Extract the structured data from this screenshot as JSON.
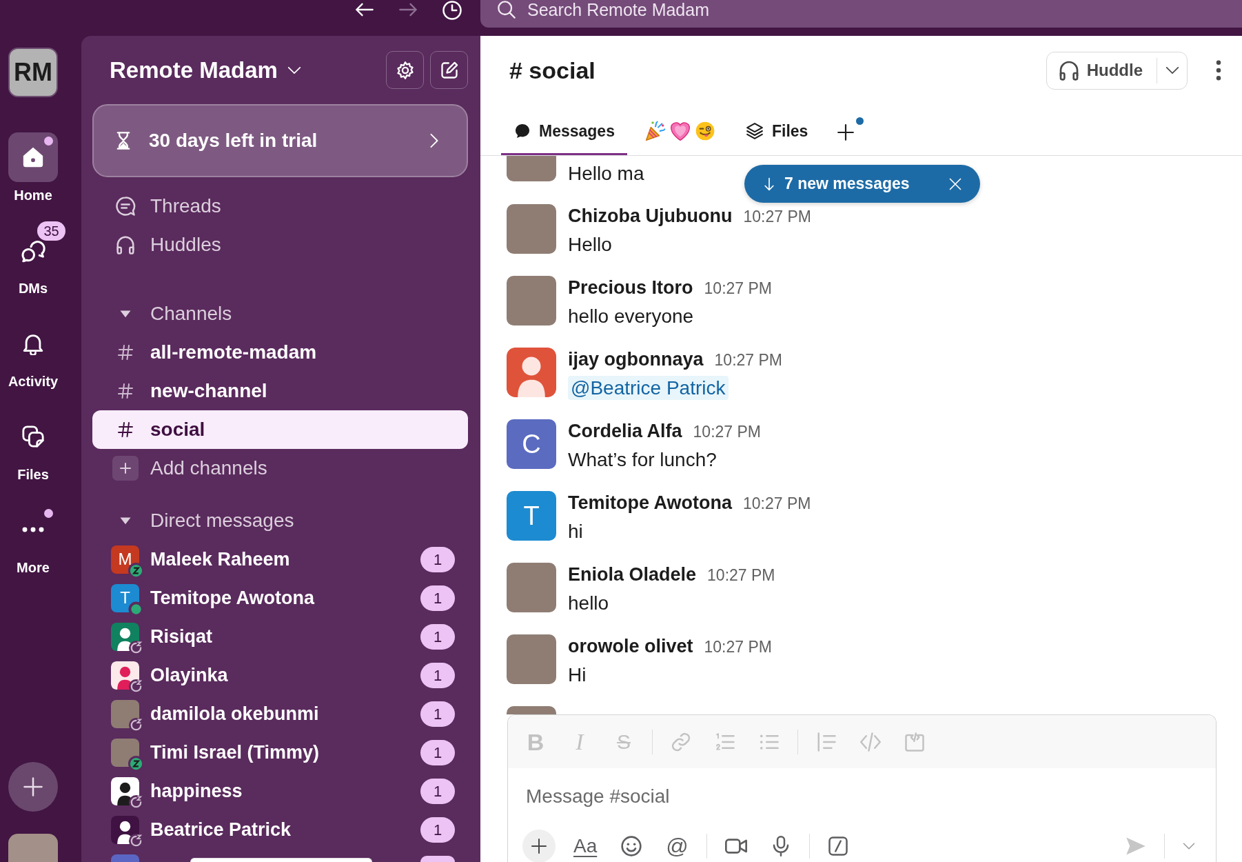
{
  "top_bar": {
    "navigation": [
      {
        "disabled": false
      },
      {
        "disabled": true
      },
      {
        "disabled": false
      }
    ],
    "search": {
      "placeholder": "Search Remote Madam"
    }
  },
  "rail": {
    "workspace": {
      "initials": "RM"
    },
    "items": [
      {
        "label": "Home",
        "selected": true,
        "dot": true
      },
      {
        "label": "DMs",
        "selected": false,
        "dot": false,
        "badge": "35"
      },
      {
        "label": "Activity",
        "selected": false,
        "dot": false
      },
      {
        "label": "Files",
        "selected": false,
        "dot": false
      },
      {
        "label": "More",
        "selected": false,
        "dot": true
      }
    ]
  },
  "sidebar": {
    "workspace_name": "Remote Madam",
    "trial_banner": "30 days left in trial",
    "nav": [
      {
        "label": "Threads"
      },
      {
        "label": "Huddles"
      }
    ],
    "channels": {
      "title": "Channels",
      "expanded": true,
      "items": [
        {
          "name": "all-remote-madam",
          "selected": false,
          "unread": true
        },
        {
          "name": "new-channel",
          "selected": false,
          "unread": true
        },
        {
          "name": "social",
          "selected": true,
          "unread": true
        }
      ],
      "add_label": "Add channels"
    },
    "direct_messages": {
      "title": "Direct messages",
      "expanded": true,
      "items": [
        {
          "kind": "full",
          "name": "Maleek Raheem",
          "badge": "1",
          "online": true,
          "snoozed": true,
          "avatar": {
            "kind": "initial",
            "initial": "M",
            "color": "#c4391f"
          }
        },
        {
          "kind": "full",
          "name": "Temitope Awotona",
          "badge": "1",
          "online": true,
          "snoozed": false,
          "avatar": {
            "kind": "initial",
            "initial": "T",
            "color": "#1d8bd1"
          }
        },
        {
          "kind": "full",
          "name": "Risiqat",
          "badge": "1",
          "online": false,
          "snoozed": true,
          "avatar": {
            "kind": "silhouette",
            "color": "#10825f",
            "figure": {
              "color": "#ffffff"
            }
          }
        },
        {
          "kind": "full",
          "name": "Olayinka",
          "badge": "1",
          "online": false,
          "snoozed": true,
          "avatar": {
            "kind": "silhouette",
            "color": "#fbe9ec",
            "figure": {
              "color": "#e01e5a"
            }
          }
        },
        {
          "kind": "full",
          "name": "damilola okebunmi",
          "badge": "1",
          "online": false,
          "snoozed": true,
          "avatar": {
            "kind": "photo"
          }
        },
        {
          "kind": "full",
          "name": "Timi Israel (Timmy)",
          "badge": "1",
          "online": true,
          "snoozed": true,
          "avatar": {
            "kind": "photo"
          }
        },
        {
          "kind": "full",
          "name": "happiness",
          "badge": "1",
          "online": false,
          "snoozed": true,
          "avatar": {
            "kind": "silhouette",
            "color": "#ffffff",
            "figure": {
              "color": "#1d1c1d"
            }
          }
        },
        {
          "kind": "full",
          "name": "Beatrice Patrick",
          "badge": "1",
          "online": false,
          "snoozed": true,
          "avatar": {
            "kind": "silhouette",
            "color": "#3f1243",
            "figure": {
              "color": "#ffffff"
            }
          }
        },
        {
          "kind": "cut",
          "avatar": {
            "kind": "initial",
            "color": "#5b66c4"
          }
        }
      ]
    }
  },
  "channel": {
    "title": "# social",
    "huddle": {
      "label": "Huddle"
    },
    "tabs": [
      {
        "label": "Messages",
        "selected": true
      },
      {
        "selected": false
      },
      {
        "label": "Files",
        "selected": false
      }
    ],
    "add_tab": {
      "dot": true
    },
    "new_messages": {
      "label": "7 new messages"
    },
    "messages": [
      {
        "kind": "continued",
        "text": "Hello ma",
        "mention": false,
        "avatar": {
          "kind": "photo"
        }
      },
      {
        "kind": "full",
        "author": "Chizoba Ujubuonu",
        "time": "10:27 PM",
        "text": "Hello",
        "mention": false,
        "avatar": {
          "kind": "photo"
        }
      },
      {
        "kind": "full",
        "author": "Precious Itoro",
        "time": "10:27 PM",
        "text": "hello everyone",
        "mention": false,
        "avatar": {
          "kind": "photo"
        }
      },
      {
        "kind": "full",
        "author": "ijay ogbonnaya",
        "time": "10:27 PM",
        "text": "@Beatrice Patrick",
        "mention": true,
        "avatar": {
          "kind": "silhouette",
          "color": "#e0533b",
          "figure": {
            "color": "#fde6e1"
          }
        }
      },
      {
        "kind": "full",
        "author": "Cordelia Alfa",
        "time": "10:27 PM",
        "text": "What’s for lunch?",
        "mention": false,
        "avatar": {
          "kind": "initial",
          "initial": "C",
          "color": "#5b6bc0"
        }
      },
      {
        "kind": "full",
        "author": "Temitope Awotona",
        "time": "10:27 PM",
        "text": "hi",
        "mention": false,
        "avatar": {
          "kind": "initial",
          "initial": "T",
          "color": "#1d8bd1"
        }
      },
      {
        "kind": "full",
        "author": "Eniola Oladele",
        "time": "10:27 PM",
        "text": "hello",
        "mention": false,
        "avatar": {
          "kind": "photo"
        }
      },
      {
        "kind": "full",
        "author": "orowole olivet",
        "time": "10:27 PM",
        "text": "Hi",
        "mention": false,
        "avatar": {
          "kind": "photo"
        }
      },
      {
        "kind": "cut",
        "avatar": {
          "kind": "photo"
        }
      }
    ],
    "composer": {
      "format_disabled": true,
      "format_glyphs": [
        "B",
        "I",
        "S"
      ],
      "placeholder": "Message #social",
      "text_style": "Aa",
      "mention_glyph": "@",
      "send_disabled": true
    }
  }
}
